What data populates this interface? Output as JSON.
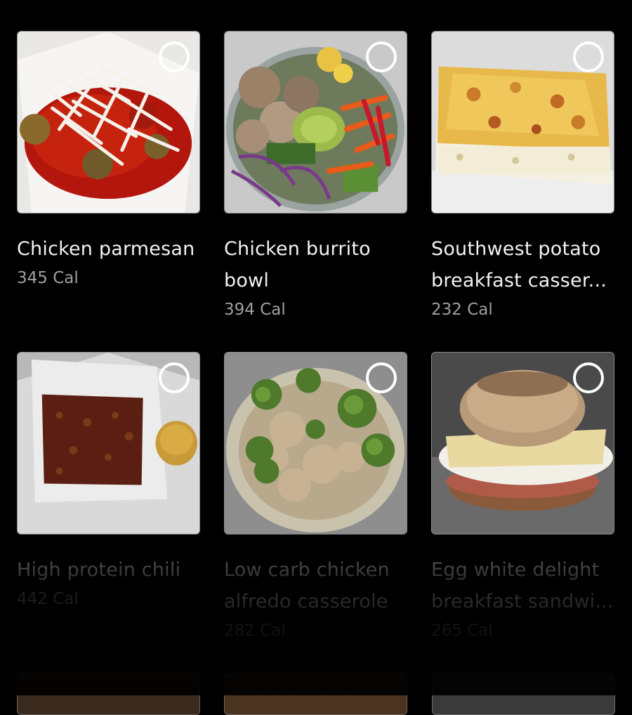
{
  "recipes": [
    {
      "title": "Chicken parmesan",
      "calories": "345 Cal",
      "image": "chicken-parmesan"
    },
    {
      "title": "Chicken burrito\nbowl",
      "calories": "394 Cal",
      "image": "burrito-bowl"
    },
    {
      "title": "Southwest potato\nbreakfast casser...",
      "calories": "232 Cal",
      "image": "breakfast-casserole"
    },
    {
      "title": "High protein chili",
      "calories": "442 Cal",
      "image": "protein-chili"
    },
    {
      "title": "Low carb chicken\nalfredo casserole",
      "calories": "282 Cal",
      "image": "alfredo-casserole"
    },
    {
      "title": "Egg white delight\nbreakfast sandwi...",
      "calories": "265 Cal",
      "image": "egg-sandwich"
    }
  ],
  "colors": {
    "background": "#000000",
    "title": "#f2f2f2",
    "calories": "#a0a0a0",
    "select_ring": "#ffffff"
  }
}
